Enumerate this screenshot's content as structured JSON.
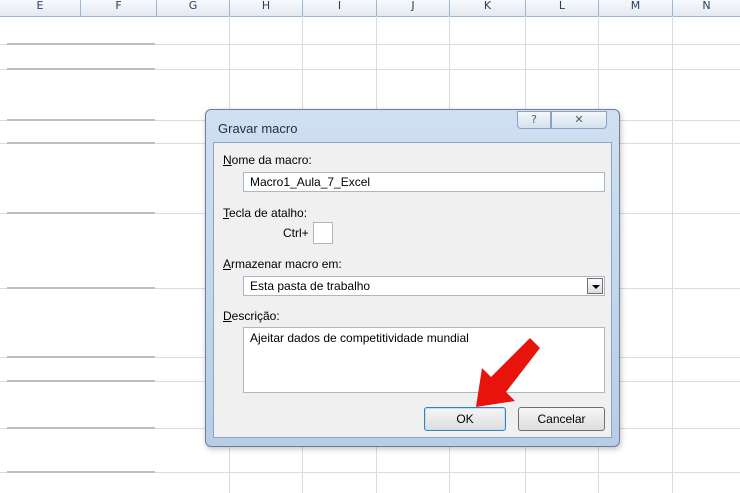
{
  "spreadsheet": {
    "columns": [
      "E",
      "F",
      "G",
      "H",
      "I",
      "J",
      "K",
      "L",
      "M",
      "N"
    ]
  },
  "dialog": {
    "title": "Gravar macro",
    "help_glyph": "?",
    "close_glyph": "✕",
    "macro_name": {
      "label_accel": "N",
      "label_rest": "ome da macro:",
      "value": "Macro1_Aula_7_Excel"
    },
    "shortcut": {
      "label_accel": "T",
      "label_rest": "ecla de atalho:",
      "prefix": "Ctrl+",
      "value": ""
    },
    "store_in": {
      "label_accel": "A",
      "label_rest": "rmazenar macro em:",
      "selected": "Esta pasta de trabalho"
    },
    "description": {
      "label_accel": "D",
      "label_rest": "escrição:",
      "value": "Ajeitar dados de competitividade mundial"
    },
    "ok_label": "OK",
    "cancel_label": "Cancelar"
  },
  "annotation": {
    "arrow_color": "#e8140c",
    "icon": "red-arrow-icon"
  }
}
